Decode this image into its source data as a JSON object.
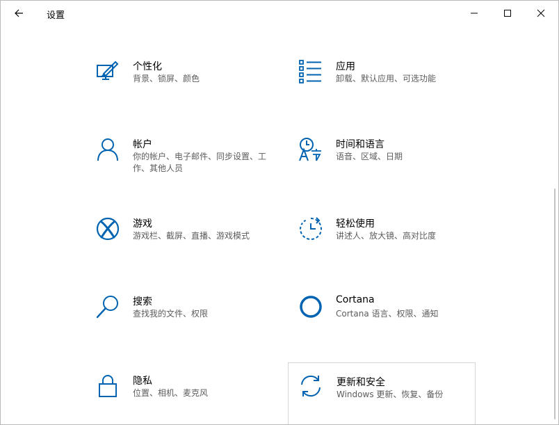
{
  "window": {
    "title": "设置"
  },
  "tiles": [
    {
      "name": "个性化",
      "desc": "背景、锁屏、颜色",
      "icon": "personalization-icon"
    },
    {
      "name": "应用",
      "desc": "卸载、默认应用、可选功能",
      "icon": "apps-icon"
    },
    {
      "name": "帐户",
      "desc": "你的帐户、电子邮件、同步设置、工作、其他人员",
      "icon": "account-icon"
    },
    {
      "name": "时间和语言",
      "desc": "语音、区域、日期",
      "icon": "time-language-icon"
    },
    {
      "name": "游戏",
      "desc": "游戏栏、截屏、直播、游戏模式",
      "icon": "xbox-icon"
    },
    {
      "name": "轻松使用",
      "desc": "讲述人、放大镜、高对比度",
      "icon": "ease-of-access-icon"
    },
    {
      "name": "搜索",
      "desc": "查找我的文件、权限",
      "icon": "search-icon"
    },
    {
      "name": "Cortana",
      "desc": "Cortana 语言、权限、通知",
      "icon": "cortana-icon"
    },
    {
      "name": "隐私",
      "desc": "位置、相机、麦克风",
      "icon": "lock-icon"
    },
    {
      "name": "更新和安全",
      "desc": "Windows 更新、恢复、备份",
      "icon": "update-icon"
    }
  ],
  "colors": {
    "accent": "#0063b1",
    "text_primary": "#000000",
    "text_secondary": "#5c5c5c"
  }
}
